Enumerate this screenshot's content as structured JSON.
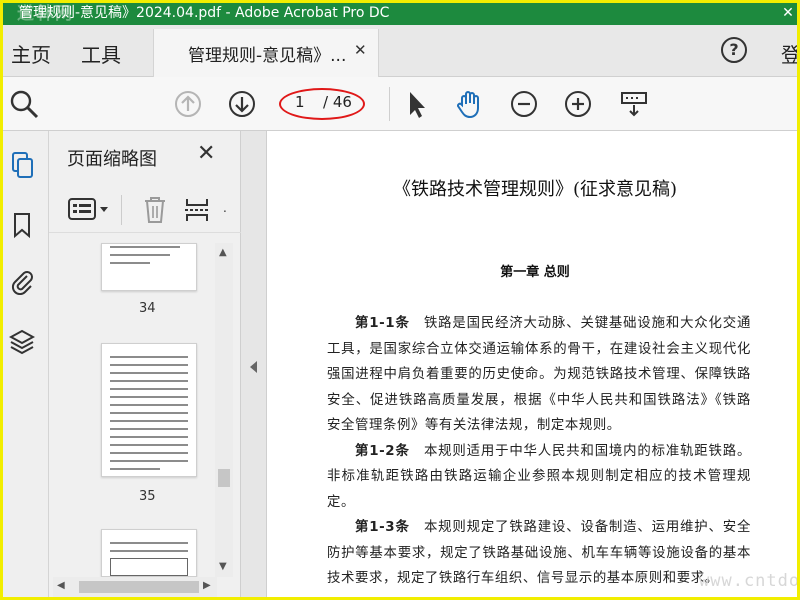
{
  "titlebar": {
    "title": "管理规则-意见稿》2024.04.pdf - Adobe Acrobat Pro DC",
    "watermark": "道林网",
    "close_symbol": "✕"
  },
  "tabs": {
    "home": "主页",
    "tools": "工具",
    "doc_tab": "管理规则-意见稿》...",
    "close_symbol": "✕",
    "help_symbol": "?",
    "login": "登"
  },
  "toolbar": {
    "page_current": "1",
    "page_total": "/ 46"
  },
  "thumbnail_panel": {
    "title": "页面缩略图",
    "close_symbol": "✕",
    "pages": [
      "34",
      "35"
    ]
  },
  "document": {
    "title": "《铁路技术管理规则》(征求意见稿)",
    "chapter": "第一章  总则",
    "articles": [
      {
        "label": "第1-1条",
        "text": "铁路是国民经济大动脉、关键基础设施和大众化交通工具，是国家综合立体交通运输体系的骨干，在建设社会主义现代化强国进程中肩负着重要的历史使命。为规范铁路技术管理、保障铁路安全、促进铁路高质量发展，根据《中华人民共和国铁路法》《铁路安全管理条例》等有关法律法规，制定本规则。"
      },
      {
        "label": "第1-2条",
        "text": "本规则适用于中华人民共和国境内的标准轨距铁路。非标准轨距铁路由铁路运输企业参照本规则制定相应的技术管理规定。"
      },
      {
        "label": "第1-3条",
        "text": "本规则规定了铁路建设、设备制造、运用维护、安全防护等基本要求，规定了铁路基础设施、机车车辆等设施设备的基本技术要求，规定了铁路行车组织、信号显示的基本原则和要求。"
      }
    ],
    "watermark": "www.cntdo.com"
  },
  "colors": {
    "titlebar": "#1d8a3e",
    "frame": "#f2ee00",
    "annotation": "#e01818"
  }
}
